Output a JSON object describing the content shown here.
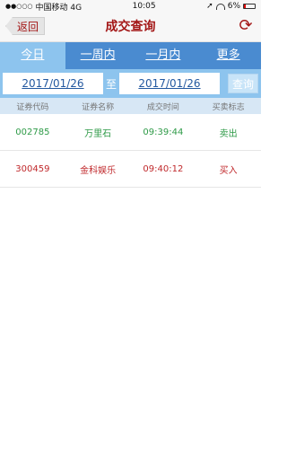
{
  "status": {
    "carrier": "中国移动 4G",
    "time": "10:05",
    "battery": "6%"
  },
  "nav": {
    "back_label": "返回",
    "title": "成交查询"
  },
  "tabs": [
    "今日",
    "一周内",
    "一月内",
    "更多"
  ],
  "filter": {
    "start_date": "2017/01/26",
    "to_label": "至",
    "end_date": "2017/01/26",
    "query_label": "查询"
  },
  "table": {
    "headers": [
      "证券代码",
      "证券名称",
      "成交时间",
      "买卖标志"
    ],
    "rows": [
      {
        "code": "002785",
        "name": "万里石",
        "time": "09:39:44",
        "side": "卖出"
      },
      {
        "code": "300459",
        "name": "金科娱乐",
        "time": "09:40:12",
        "side": "买入"
      }
    ]
  },
  "colors": {
    "accent": "#a31616",
    "tab_bar": "#4a8bd0",
    "tab_active": "#8dc4ee",
    "sell": "#2e9a47",
    "buy": "#c0292c"
  }
}
